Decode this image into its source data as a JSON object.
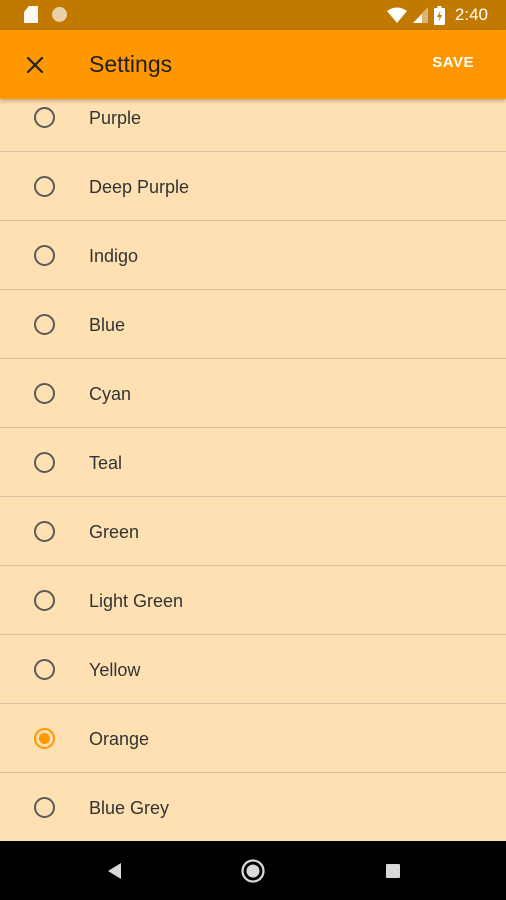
{
  "status_bar": {
    "time": "2:40",
    "icons": [
      "sd-card-icon",
      "circle-icon",
      "wifi-icon",
      "signal-icon",
      "battery-icon"
    ]
  },
  "app_bar": {
    "title": "Settings",
    "save_label": "SAVE",
    "close_icon": "close-icon"
  },
  "options": [
    {
      "label": "Purple",
      "selected": false
    },
    {
      "label": "Deep Purple",
      "selected": false
    },
    {
      "label": "Indigo",
      "selected": false
    },
    {
      "label": "Blue",
      "selected": false
    },
    {
      "label": "Cyan",
      "selected": false
    },
    {
      "label": "Teal",
      "selected": false
    },
    {
      "label": "Green",
      "selected": false
    },
    {
      "label": "Light Green",
      "selected": false
    },
    {
      "label": "Yellow",
      "selected": false
    },
    {
      "label": "Orange",
      "selected": true
    },
    {
      "label": "Blue Grey",
      "selected": false
    }
  ],
  "colors": {
    "accent": "#ff9800",
    "status_bar": "#c17900",
    "background": "#ffe0b2",
    "nav_bar": "#000000"
  },
  "nav_bar": {
    "buttons": [
      "back-icon",
      "home-icon",
      "recents-icon"
    ]
  }
}
